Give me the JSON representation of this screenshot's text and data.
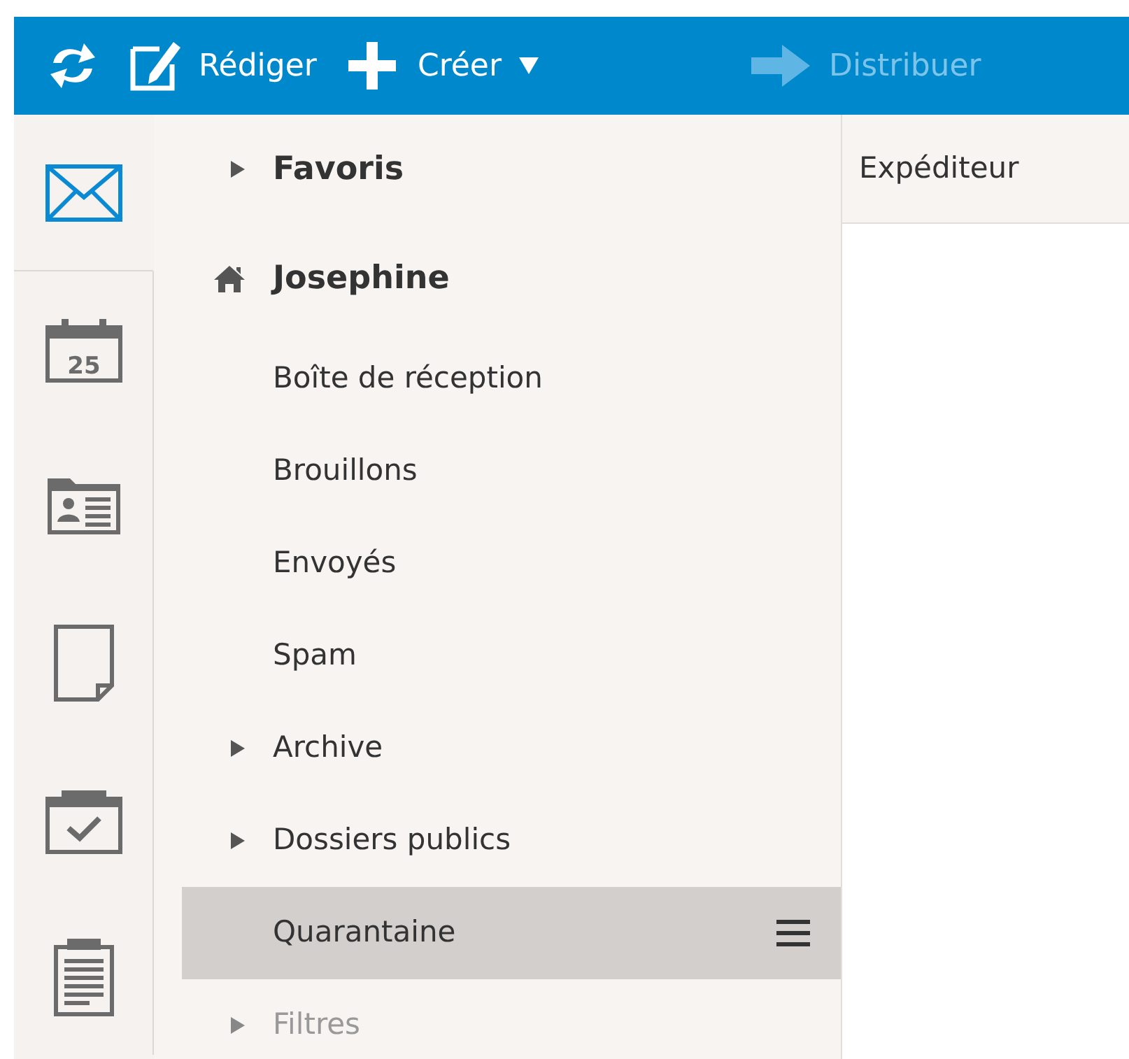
{
  "toolbar": [
    {
      "kind": "refresh",
      "disabled": false
    },
    {
      "kind": "compose",
      "label": "Rédiger",
      "disabled": false
    },
    {
      "kind": "create",
      "label": "Créer",
      "disabled": false
    },
    {
      "kind": "forward",
      "label": "Distribuer",
      "disabled": true
    }
  ],
  "rail": [
    {
      "kind": "mail",
      "selected": true
    },
    {
      "kind": "calendar",
      "selected": false,
      "text": "25"
    },
    {
      "kind": "contacts",
      "selected": false
    },
    {
      "kind": "notes",
      "selected": false
    },
    {
      "kind": "tasks",
      "selected": false
    },
    {
      "kind": "clipboard",
      "selected": false
    }
  ],
  "folders": [
    {
      "label": "Favoris",
      "kind": "section",
      "expanded": false
    },
    {
      "label": "Josephine",
      "kind": "account",
      "expanded": true,
      "children": [
        {
          "label": "Boîte de réception",
          "selected": false,
          "disabled": false
        },
        {
          "label": "Brouillons",
          "selected": false,
          "disabled": false
        },
        {
          "label": "Envoyés",
          "selected": false,
          "disabled": false
        },
        {
          "label": "Spam",
          "selected": false,
          "disabled": false
        },
        {
          "label": "Archive",
          "selected": false,
          "disabled": false,
          "expanded": false
        },
        {
          "label": "Dossiers publics",
          "selected": false,
          "disabled": false,
          "expanded": false
        },
        {
          "label": "Quarantaine",
          "selected": true,
          "disabled": false
        },
        {
          "label": "Filtres",
          "selected": false,
          "disabled": true,
          "expanded": false
        }
      ]
    }
  ],
  "message_list": {
    "columns": [
      "Expéditeur"
    ]
  }
}
